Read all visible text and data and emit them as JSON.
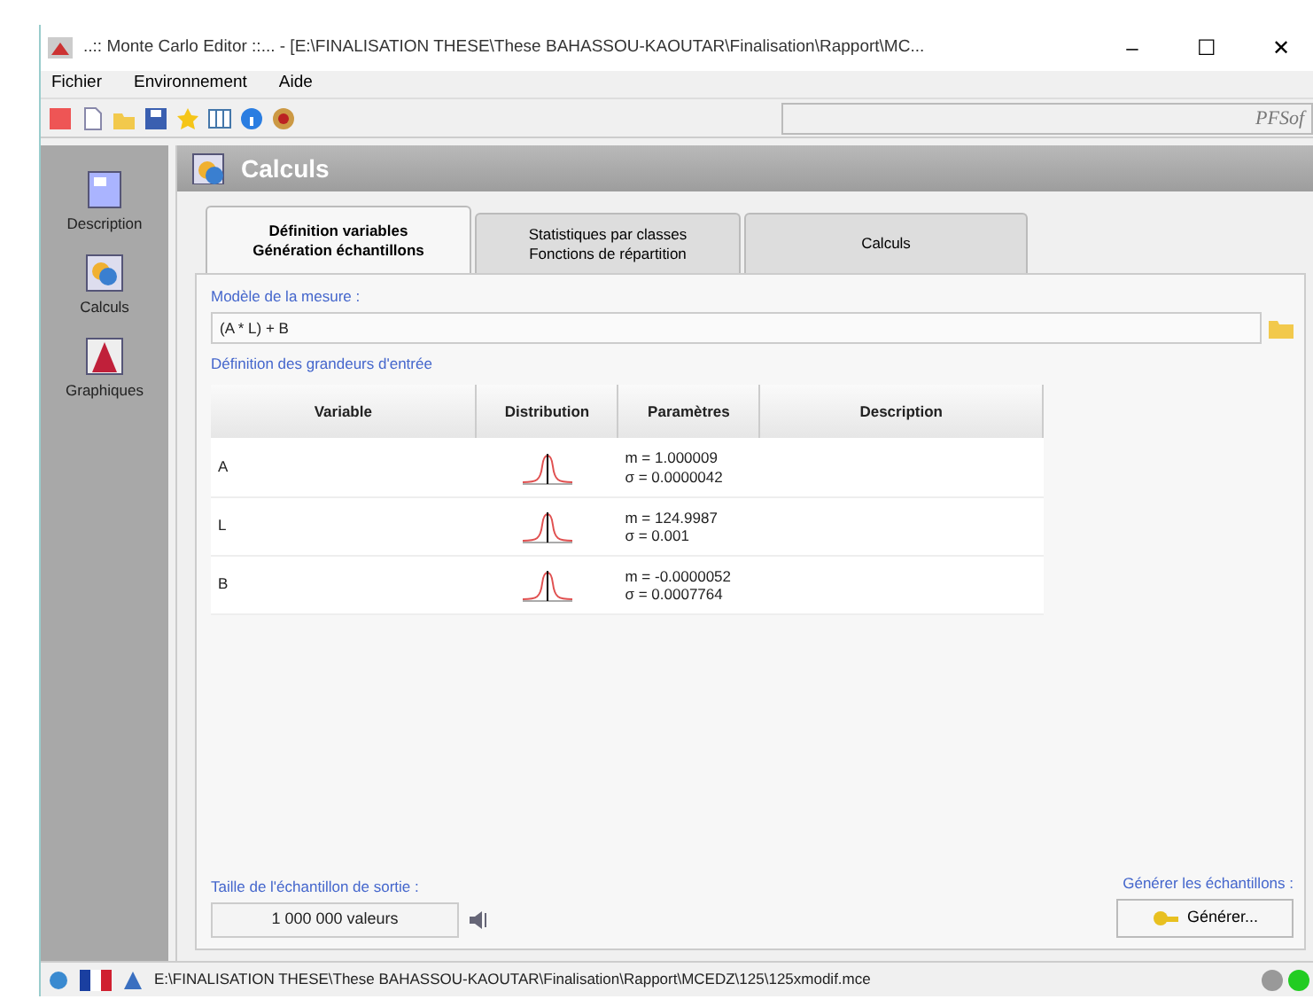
{
  "window": {
    "title": "..:: Monte Carlo Editor ::... - [E:\\FINALISATION THESE\\These BAHASSOU-KAOUTAR\\Finalisation\\Rapport\\MC...",
    "controls": [
      "–",
      "☐",
      "✕"
    ]
  },
  "menu": [
    "Fichier",
    "Environnement",
    "Aide"
  ],
  "toolbar": {
    "brand": "PFSof"
  },
  "sidebar": {
    "items": [
      {
        "label": "Description",
        "kind": "page"
      },
      {
        "label": "Calculs",
        "kind": "calc"
      },
      {
        "label": "Graphiques",
        "kind": "chart"
      }
    ]
  },
  "panel": {
    "title": "Calculs",
    "tabs": [
      {
        "lines": [
          "Définition variables",
          "Génération échantillons"
        ],
        "selected": true
      },
      {
        "lines": [
          "Statistiques par classes",
          "Fonctions de répartition"
        ],
        "selected": false
      },
      {
        "lines": [
          "Calculs"
        ],
        "selected": false
      }
    ],
    "model": {
      "label": "Modèle de la mesure :",
      "value": "(A * L) + B"
    },
    "inputs_label": "Définition des grandeurs d'entrée",
    "table": {
      "columns": [
        "Variable",
        "Distribution",
        "Paramètres",
        "Description"
      ],
      "rows": [
        {
          "variable": "A",
          "parameters": [
            "m = 1.000009",
            "σ = 0.0000042"
          ]
        },
        {
          "variable": "L",
          "parameters": [
            "m = 124.9987",
            "σ = 0.001"
          ]
        },
        {
          "variable": "B",
          "parameters": [
            "m = -0.0000052",
            "σ = 0.0007764"
          ]
        }
      ]
    },
    "sample_size": {
      "label": "Taille de l'échantillon de sortie :",
      "value": "1 000 000 valeurs"
    },
    "generate": {
      "label": "Générer les échantillons :",
      "button": "Générer..."
    }
  },
  "status_bar": {
    "path": "E:\\FINALISATION THESE\\These BAHASSOU-KAOUTAR\\Finalisation\\Rapport\\MCEDZ\\125\\125xmodif.mce"
  }
}
